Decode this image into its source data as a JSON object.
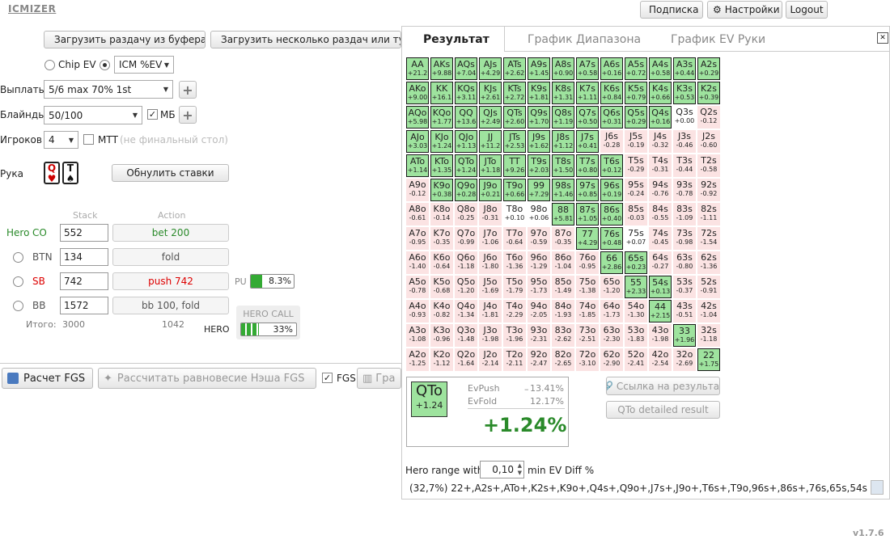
{
  "app": {
    "logo": "ICMIZER",
    "version": "v1.7.6"
  },
  "topbar": {
    "subscription": "Подписка",
    "settings": "Настройки",
    "logout": "Logout"
  },
  "toolbar": {
    "load_clipboard": "Загрузить раздачу из буфера",
    "load_multiple": "Загрузить несколько раздач или тур"
  },
  "model": {
    "chip_ev": "Chip EV",
    "icm": "ICM %EV"
  },
  "payouts": {
    "label": "Выплаты",
    "value": "5/6 max 70% 1st"
  },
  "blinds": {
    "label": "Блайнды",
    "value": "50/100",
    "bb_check": "МБ"
  },
  "players": {
    "label": "Игроков",
    "value": "4",
    "mtt": "МТТ",
    "mtt_note": "(не финальный стол)"
  },
  "hand": {
    "label": "Рука",
    "card1": "Q",
    "card1_suit": "♥",
    "card2": "T",
    "card2_suit": "♠",
    "reset": "Обнулить ставки"
  },
  "table_headers": {
    "stack": "Stack",
    "action": "Action"
  },
  "seats": [
    {
      "pos": "CO",
      "name": "Hero",
      "stack": "552",
      "action": "bet 200",
      "color": "#2a8a2a",
      "active": true
    },
    {
      "pos": "BTN",
      "name": "",
      "stack": "134",
      "action": "fold",
      "color": "#555",
      "active": false
    },
    {
      "pos": "SB",
      "name": "",
      "stack": "742",
      "action": "push 742",
      "color": "#d00",
      "active": false
    },
    {
      "pos": "BB",
      "name": "",
      "stack": "1572",
      "action": "bb 100, fold",
      "color": "#555",
      "active": false
    }
  ],
  "pu": {
    "label": "PU",
    "value": "8.3%",
    "fill": 0.083
  },
  "totals": {
    "label": "Итого:",
    "stack": "3000",
    "action": "1042"
  },
  "hero_call": {
    "title": "HERO CALL",
    "label": "HERO",
    "value": "33%",
    "fill": 0.33
  },
  "bottom": {
    "calc_fgs": "Расчет FGS",
    "nash": "Рассчитать равновесие Нэша FGS",
    "fgs": "FGS",
    "graph": "Гра"
  },
  "result": {
    "tabs": [
      "Результат",
      "График Диапазона",
      "График EV Руки"
    ],
    "close": "✕",
    "rows": [
      [
        [
          "AA",
          "+21.2",
          "g"
        ],
        [
          "AKs",
          "+9.88",
          "g"
        ],
        [
          "AQs",
          "+7.04",
          "g"
        ],
        [
          "AJs",
          "+4.29",
          "g"
        ],
        [
          "ATs",
          "+2.62",
          "g"
        ],
        [
          "A9s",
          "+1.45",
          "g"
        ],
        [
          "A8s",
          "+0.90",
          "g"
        ],
        [
          "A7s",
          "+0.58",
          "g"
        ],
        [
          "A6s",
          "+0.16",
          "g"
        ],
        [
          "A5s",
          "+0.72",
          "g"
        ],
        [
          "A4s",
          "+0.58",
          "g"
        ],
        [
          "A3s",
          "+0.44",
          "g"
        ],
        [
          "A2s",
          "+0.29",
          "g"
        ]
      ],
      [
        [
          "AKo",
          "+9.00",
          "g"
        ],
        [
          "KK",
          "+16.1",
          "g"
        ],
        [
          "KQs",
          "+3.11",
          "g"
        ],
        [
          "KJs",
          "+2.61",
          "g"
        ],
        [
          "KTs",
          "+2.72",
          "g"
        ],
        [
          "K9s",
          "+1.81",
          "g"
        ],
        [
          "K8s",
          "+1.31",
          "g"
        ],
        [
          "K7s",
          "+1.11",
          "g"
        ],
        [
          "K6s",
          "+0.84",
          "g"
        ],
        [
          "K5s",
          "+0.79",
          "g"
        ],
        [
          "K4s",
          "+0.66",
          "g"
        ],
        [
          "K3s",
          "+0.53",
          "g"
        ],
        [
          "K2s",
          "+0.39",
          "g"
        ]
      ],
      [
        [
          "AQo",
          "+5.98",
          "g"
        ],
        [
          "KQo",
          "+1.77",
          "g"
        ],
        [
          "QQ",
          "+13.6",
          "g"
        ],
        [
          "QJs",
          "+2.49",
          "g"
        ],
        [
          "QTs",
          "+2.60",
          "g"
        ],
        [
          "Q9s",
          "+1.70",
          "g"
        ],
        [
          "Q8s",
          "+1.19",
          "g"
        ],
        [
          "Q7s",
          "+0.50",
          "g"
        ],
        [
          "Q6s",
          "+0.31",
          "g"
        ],
        [
          "Q5s",
          "+0.29",
          "g"
        ],
        [
          "Q4s",
          "+0.16",
          "g"
        ],
        [
          "Q3s",
          "+0.00",
          "w"
        ],
        [
          "Q2s",
          "-0.12",
          "p"
        ]
      ],
      [
        [
          "AJo",
          "+3.03",
          "g"
        ],
        [
          "KJo",
          "+1.24",
          "g"
        ],
        [
          "QJo",
          "+1.13",
          "g"
        ],
        [
          "JJ",
          "+11.2",
          "g"
        ],
        [
          "JTs",
          "+2.53",
          "g"
        ],
        [
          "J9s",
          "+1.62",
          "g"
        ],
        [
          "J8s",
          "+1.12",
          "g"
        ],
        [
          "J7s",
          "+0.41",
          "g"
        ],
        [
          "J6s",
          "-0.28",
          "p"
        ],
        [
          "J5s",
          "-0.19",
          "p"
        ],
        [
          "J4s",
          "-0.32",
          "p"
        ],
        [
          "J3s",
          "-0.46",
          "p"
        ],
        [
          "J2s",
          "-0.60",
          "p"
        ]
      ],
      [
        [
          "ATo",
          "+1.14",
          "g"
        ],
        [
          "KTo",
          "+1.35",
          "g"
        ],
        [
          "QTo",
          "+1.24",
          "g"
        ],
        [
          "JTo",
          "+1.18",
          "g"
        ],
        [
          "TT",
          "+9.26",
          "g"
        ],
        [
          "T9s",
          "+2.03",
          "g"
        ],
        [
          "T8s",
          "+1.50",
          "g"
        ],
        [
          "T7s",
          "+0.80",
          "g"
        ],
        [
          "T6s",
          "+0.12",
          "g"
        ],
        [
          "T5s",
          "-0.29",
          "p"
        ],
        [
          "T4s",
          "-0.31",
          "p"
        ],
        [
          "T3s",
          "-0.44",
          "p"
        ],
        [
          "T2s",
          "-0.58",
          "p"
        ]
      ],
      [
        [
          "A9o",
          "-0.12",
          "p"
        ],
        [
          "K9o",
          "+0.38",
          "g"
        ],
        [
          "Q9o",
          "+0.28",
          "g"
        ],
        [
          "J9o",
          "+0.21",
          "g"
        ],
        [
          "T9o",
          "+0.66",
          "g"
        ],
        [
          "99",
          "+7.29",
          "g"
        ],
        [
          "98s",
          "+1.46",
          "g"
        ],
        [
          "97s",
          "+0.85",
          "g"
        ],
        [
          "96s",
          "+0.19",
          "g"
        ],
        [
          "95s",
          "-0.24",
          "p"
        ],
        [
          "94s",
          "-0.76",
          "p"
        ],
        [
          "93s",
          "-0.78",
          "p"
        ],
        [
          "92s",
          "-0.92",
          "p"
        ]
      ],
      [
        [
          "A8o",
          "-0.61",
          "p"
        ],
        [
          "K8o",
          "-0.14",
          "p"
        ],
        [
          "Q8o",
          "-0.25",
          "p"
        ],
        [
          "J8o",
          "-0.31",
          "p"
        ],
        [
          "T8o",
          "+0.10",
          "w"
        ],
        [
          "98o",
          "+0.06",
          "w"
        ],
        [
          "88",
          "+5.81",
          "g"
        ],
        [
          "87s",
          "+1.05",
          "g"
        ],
        [
          "86s",
          "+0.40",
          "g"
        ],
        [
          "85s",
          "-0.03",
          "p"
        ],
        [
          "84s",
          "-0.55",
          "p"
        ],
        [
          "83s",
          "-1.09",
          "p"
        ],
        [
          "82s",
          "-1.11",
          "p"
        ]
      ],
      [
        [
          "A7o",
          "-0.95",
          "p"
        ],
        [
          "K7o",
          "-0.35",
          "p"
        ],
        [
          "Q7o",
          "-0.99",
          "p"
        ],
        [
          "J7o",
          "-1.06",
          "p"
        ],
        [
          "T7o",
          "-0.64",
          "p"
        ],
        [
          "97o",
          "-0.59",
          "p"
        ],
        [
          "87o",
          "-0.35",
          "p"
        ],
        [
          "77",
          "+4.29",
          "g"
        ],
        [
          "76s",
          "+0.48",
          "g"
        ],
        [
          "75s",
          "+0.07",
          "w"
        ],
        [
          "74s",
          "-0.45",
          "p"
        ],
        [
          "73s",
          "-0.98",
          "p"
        ],
        [
          "72s",
          "-1.54",
          "p"
        ]
      ],
      [
        [
          "A6o",
          "-1.40",
          "p"
        ],
        [
          "K6o",
          "-0.64",
          "p"
        ],
        [
          "Q6o",
          "-1.18",
          "p"
        ],
        [
          "J6o",
          "-1.80",
          "p"
        ],
        [
          "T6o",
          "-1.36",
          "p"
        ],
        [
          "96o",
          "-1.29",
          "p"
        ],
        [
          "86o",
          "-1.04",
          "p"
        ],
        [
          "76o",
          "-0.95",
          "p"
        ],
        [
          "66",
          "+2.86",
          "g"
        ],
        [
          "65s",
          "+0.23",
          "g"
        ],
        [
          "64s",
          "-0.27",
          "p"
        ],
        [
          "63s",
          "-0.80",
          "p"
        ],
        [
          "62s",
          "-1.36",
          "p"
        ]
      ],
      [
        [
          "A5o",
          "-0.78",
          "p"
        ],
        [
          "K5o",
          "-0.68",
          "p"
        ],
        [
          "Q5o",
          "-1.20",
          "p"
        ],
        [
          "J5o",
          "-1.69",
          "p"
        ],
        [
          "T5o",
          "-1.79",
          "p"
        ],
        [
          "95o",
          "-1.73",
          "p"
        ],
        [
          "85o",
          "-1.49",
          "p"
        ],
        [
          "75o",
          "-1.38",
          "p"
        ],
        [
          "65o",
          "-1.20",
          "p"
        ],
        [
          "55",
          "+2.33",
          "g"
        ],
        [
          "54s",
          "+0.13",
          "g"
        ],
        [
          "53s",
          "-0.37",
          "p"
        ],
        [
          "52s",
          "-0.91",
          "p"
        ]
      ],
      [
        [
          "A4o",
          "-0.93",
          "p"
        ],
        [
          "K4o",
          "-0.82",
          "p"
        ],
        [
          "Q4o",
          "-1.34",
          "p"
        ],
        [
          "J4o",
          "-1.81",
          "p"
        ],
        [
          "T4o",
          "-2.29",
          "p"
        ],
        [
          "94o",
          "-2.05",
          "p"
        ],
        [
          "84o",
          "-1.93",
          "p"
        ],
        [
          "74o",
          "-1.85",
          "p"
        ],
        [
          "64o",
          "-1.73",
          "p"
        ],
        [
          "54o",
          "-1.30",
          "p"
        ],
        [
          "44",
          "+2.15",
          "g"
        ],
        [
          "43s",
          "-0.51",
          "p"
        ],
        [
          "42s",
          "-1.04",
          "p"
        ]
      ],
      [
        [
          "A3o",
          "-1.08",
          "p"
        ],
        [
          "K3o",
          "-0.96",
          "p"
        ],
        [
          "Q3o",
          "-1.48",
          "p"
        ],
        [
          "J3o",
          "-1.98",
          "p"
        ],
        [
          "T3o",
          "-1.96",
          "p"
        ],
        [
          "93o",
          "-2.31",
          "p"
        ],
        [
          "83o",
          "-2.62",
          "p"
        ],
        [
          "73o",
          "-2.51",
          "p"
        ],
        [
          "63o",
          "-2.30",
          "p"
        ],
        [
          "53o",
          "-1.83",
          "p"
        ],
        [
          "43o",
          "-1.98",
          "p"
        ],
        [
          "33",
          "+1.96",
          "g"
        ],
        [
          "32s",
          "-1.18",
          "p"
        ]
      ],
      [
        [
          "A2o",
          "-1.25",
          "p"
        ],
        [
          "K2o",
          "-1.12",
          "p"
        ],
        [
          "Q2o",
          "-1.64",
          "p"
        ],
        [
          "J2o",
          "-2.14",
          "p"
        ],
        [
          "T2o",
          "-2.11",
          "p"
        ],
        [
          "92o",
          "-2.47",
          "p"
        ],
        [
          "82o",
          "-2.65",
          "p"
        ],
        [
          "72o",
          "-3.10",
          "p"
        ],
        [
          "62o",
          "-2.90",
          "p"
        ],
        [
          "52o",
          "-2.41",
          "p"
        ],
        [
          "42o",
          "-2.54",
          "p"
        ],
        [
          "32o",
          "-2.69",
          "p"
        ],
        [
          "22",
          "+1.75",
          "g"
        ]
      ]
    ],
    "detail": {
      "hand": "QTo",
      "hand_ev": "+1.24",
      "evpush_label": "EvPush",
      "evpush": "13.41%",
      "evfold_label": "EvFold",
      "evfold": "12.17%",
      "diff": "+1.24%"
    },
    "link": "Ссылка на результат",
    "detailed": "QTo detailed result",
    "hero_range_label": "Hero range with",
    "hero_range_value": "0,10",
    "min_ev_label": "min EV Diff %",
    "range_text": "(32,7%) 22+,A2s+,ATo+,K2s+,K9o+,Q4s+,Q9o+,J7s+,J9o+,T6s+,T9o,96s+,86s+,76s,65s,54s"
  }
}
